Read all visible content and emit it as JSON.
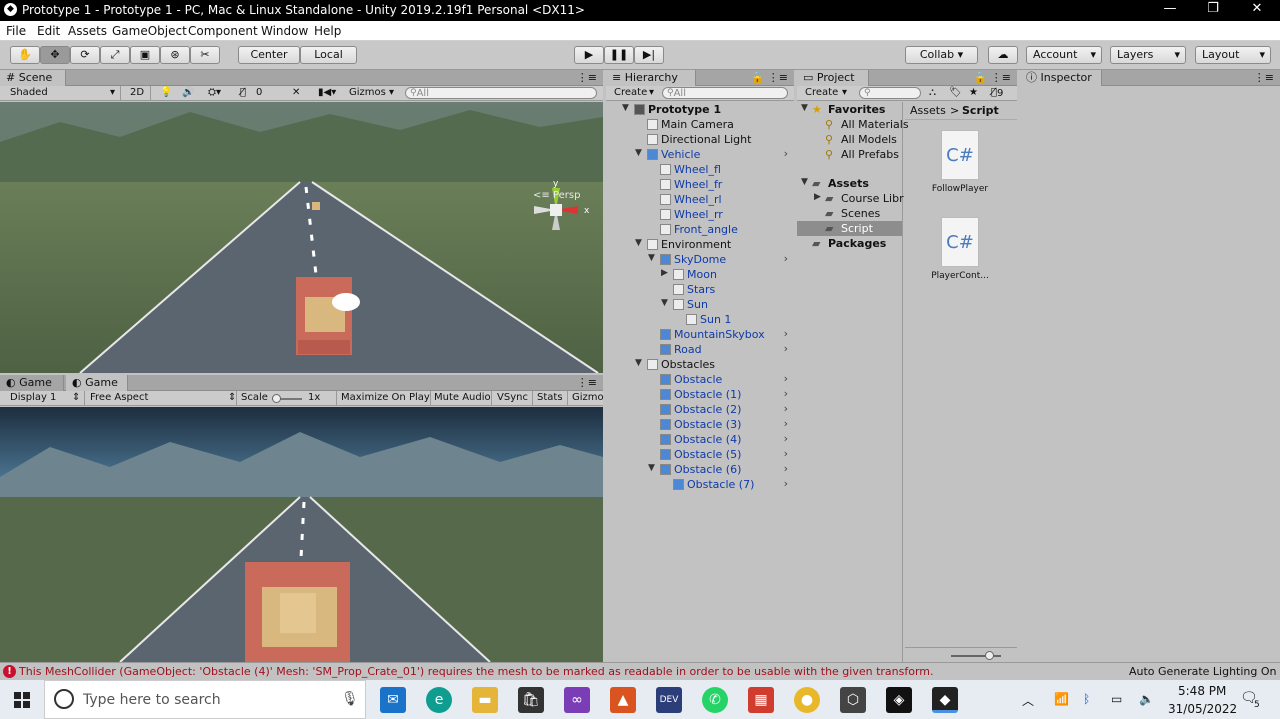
{
  "window": {
    "title": "Prototype 1 - Prototype 1 - PC, Mac & Linux Standalone - Unity 2019.2.19f1 Personal <DX11>",
    "minimize": "—",
    "maximize": "❐",
    "close": "✕"
  },
  "menu": [
    "File",
    "Edit",
    "Assets",
    "GameObject",
    "Component",
    "Window",
    "Help"
  ],
  "toolbar": {
    "pivot": "Center",
    "space": "Local",
    "collab": "Collab",
    "account": "Account",
    "layers": "Layers",
    "layout": "Layout"
  },
  "scene": {
    "tab": "Scene",
    "shading": "Shaded",
    "mode2d": "2D",
    "hidden_count": "0",
    "gizmos": "Gizmos",
    "search_placeholder": "All",
    "persp": "Persp",
    "axis_x": "x",
    "axis_y": "y"
  },
  "game": {
    "tab1": "Game",
    "tab2": "Game",
    "display": "Display 1",
    "aspect": "Free Aspect",
    "scale_label": "Scale",
    "scale_value": "1x",
    "maximize": "Maximize On Play",
    "mute": "Mute Audio",
    "vsync": "VSync",
    "stats": "Stats",
    "gizmos": "Gizmo"
  },
  "hierarchy": {
    "tab": "Hierarchy",
    "create": "Create",
    "search_placeholder": "All",
    "rows": [
      {
        "label": "Prototype 1",
        "depth": 0,
        "arrow": "down",
        "bold": true,
        "icon": "unity"
      },
      {
        "label": "Main Camera",
        "depth": 1,
        "icon": "cube-gray"
      },
      {
        "label": "Directional Light",
        "depth": 1,
        "icon": "cube-gray"
      },
      {
        "label": "Vehicle",
        "depth": 1,
        "arrow": "down",
        "icon": "cube-blue",
        "blue": true,
        "more": true
      },
      {
        "label": "Wheel_fl",
        "depth": 2,
        "icon": "cube-gray",
        "blue": true
      },
      {
        "label": "Wheel_fr",
        "depth": 2,
        "icon": "cube-gray",
        "blue": true
      },
      {
        "label": "Wheel_rl",
        "depth": 2,
        "icon": "cube-gray",
        "blue": true
      },
      {
        "label": "Wheel_rr",
        "depth": 2,
        "icon": "cube-gray",
        "blue": true
      },
      {
        "label": "Front_angle",
        "depth": 2,
        "icon": "cube-gray",
        "blue": true
      },
      {
        "label": "Environment",
        "depth": 1,
        "arrow": "down",
        "icon": "cube-gray"
      },
      {
        "label": "SkyDome",
        "depth": 2,
        "arrow": "down",
        "icon": "cube-blue",
        "blue": true,
        "more": true
      },
      {
        "label": "Moon",
        "depth": 3,
        "arrow": "right",
        "icon": "cube-gray",
        "blue": true
      },
      {
        "label": "Stars",
        "depth": 3,
        "icon": "cube-gray",
        "blue": true
      },
      {
        "label": "Sun",
        "depth": 3,
        "arrow": "down",
        "icon": "cube-gray",
        "blue": true
      },
      {
        "label": "Sun 1",
        "depth": 4,
        "icon": "cube-gray",
        "blue": true
      },
      {
        "label": "MountainSkybox",
        "depth": 2,
        "icon": "cube-blue",
        "blue": true,
        "more": true
      },
      {
        "label": "Road",
        "depth": 2,
        "icon": "cube-blue",
        "blue": true,
        "more": true
      },
      {
        "label": "Obstacles",
        "depth": 1,
        "arrow": "down",
        "icon": "cube-gray"
      },
      {
        "label": "Obstacle",
        "depth": 2,
        "icon": "cube-blue",
        "blue": true,
        "more": true
      },
      {
        "label": "Obstacle (1)",
        "depth": 2,
        "icon": "cube-blue",
        "blue": true,
        "more": true
      },
      {
        "label": "Obstacle (2)",
        "depth": 2,
        "icon": "cube-blue",
        "blue": true,
        "more": true
      },
      {
        "label": "Obstacle (3)",
        "depth": 2,
        "icon": "cube-blue",
        "blue": true,
        "more": true
      },
      {
        "label": "Obstacle (4)",
        "depth": 2,
        "icon": "cube-blue",
        "blue": true,
        "more": true
      },
      {
        "label": "Obstacle (5)",
        "depth": 2,
        "icon": "cube-blue",
        "blue": true,
        "more": true
      },
      {
        "label": "Obstacle (6)",
        "depth": 2,
        "arrow": "down",
        "icon": "cube-blue",
        "blue": true,
        "more": true
      },
      {
        "label": "Obstacle (7)",
        "depth": 3,
        "icon": "cube-blue",
        "blue": true,
        "more": true
      }
    ]
  },
  "project": {
    "tab": "Project",
    "create": "Create",
    "count": "9",
    "favorites": "Favorites",
    "fav_items": [
      "All Materials",
      "All Models",
      "All Prefabs"
    ],
    "assets": "Assets",
    "asset_items": [
      "Course Libr",
      "Scenes",
      "Script"
    ],
    "packages": "Packages",
    "breadcrumb_root": "Assets",
    "breadcrumb_sep": ">",
    "breadcrumb_current": "Script",
    "files": [
      {
        "name": "FollowPlayer",
        "glyph": "C#"
      },
      {
        "name": "PlayerCont...",
        "glyph": "C#"
      }
    ]
  },
  "inspector": {
    "tab": "Inspector"
  },
  "status": {
    "error": "This MeshCollider (GameObject: 'Obstacle (4)' Mesh: 'SM_Prop_Crate_01') requires the mesh to be marked as readable in order to be usable with the given transform.",
    "lighting": "Auto Generate Lighting On"
  },
  "taskbar": {
    "search_placeholder": "Type here to search",
    "time": "5:48 PM",
    "date": "31/05/2022",
    "notif": "5"
  },
  "colors": {
    "accent": "#0e3aa8",
    "error": "#c8102e",
    "titlebar": "#000000"
  }
}
